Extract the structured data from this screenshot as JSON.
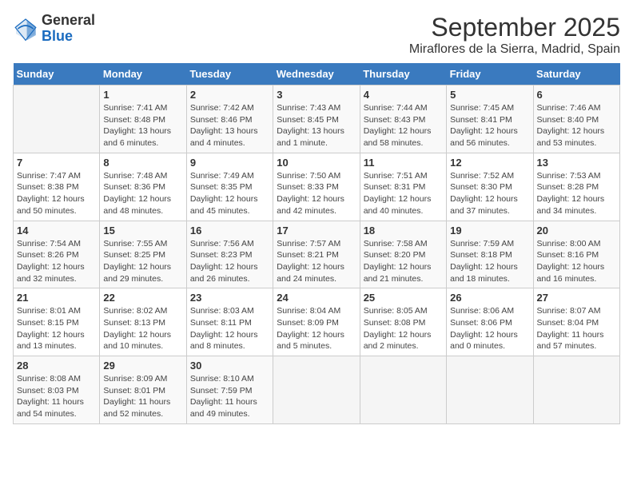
{
  "logo": {
    "general": "General",
    "blue": "Blue"
  },
  "title": "September 2025",
  "subtitle": "Miraflores de la Sierra, Madrid, Spain",
  "weekdays": [
    "Sunday",
    "Monday",
    "Tuesday",
    "Wednesday",
    "Thursday",
    "Friday",
    "Saturday"
  ],
  "weeks": [
    [
      null,
      {
        "day": 1,
        "sunrise": "7:41 AM",
        "sunset": "8:48 PM",
        "daylight": "13 hours and 6 minutes."
      },
      {
        "day": 2,
        "sunrise": "7:42 AM",
        "sunset": "8:46 PM",
        "daylight": "13 hours and 4 minutes."
      },
      {
        "day": 3,
        "sunrise": "7:43 AM",
        "sunset": "8:45 PM",
        "daylight": "13 hours and 1 minute."
      },
      {
        "day": 4,
        "sunrise": "7:44 AM",
        "sunset": "8:43 PM",
        "daylight": "12 hours and 58 minutes."
      },
      {
        "day": 5,
        "sunrise": "7:45 AM",
        "sunset": "8:41 PM",
        "daylight": "12 hours and 56 minutes."
      },
      {
        "day": 6,
        "sunrise": "7:46 AM",
        "sunset": "8:40 PM",
        "daylight": "12 hours and 53 minutes."
      }
    ],
    [
      {
        "day": 7,
        "sunrise": "7:47 AM",
        "sunset": "8:38 PM",
        "daylight": "12 hours and 50 minutes."
      },
      {
        "day": 8,
        "sunrise": "7:48 AM",
        "sunset": "8:36 PM",
        "daylight": "12 hours and 48 minutes."
      },
      {
        "day": 9,
        "sunrise": "7:49 AM",
        "sunset": "8:35 PM",
        "daylight": "12 hours and 45 minutes."
      },
      {
        "day": 10,
        "sunrise": "7:50 AM",
        "sunset": "8:33 PM",
        "daylight": "12 hours and 42 minutes."
      },
      {
        "day": 11,
        "sunrise": "7:51 AM",
        "sunset": "8:31 PM",
        "daylight": "12 hours and 40 minutes."
      },
      {
        "day": 12,
        "sunrise": "7:52 AM",
        "sunset": "8:30 PM",
        "daylight": "12 hours and 37 minutes."
      },
      {
        "day": 13,
        "sunrise": "7:53 AM",
        "sunset": "8:28 PM",
        "daylight": "12 hours and 34 minutes."
      }
    ],
    [
      {
        "day": 14,
        "sunrise": "7:54 AM",
        "sunset": "8:26 PM",
        "daylight": "12 hours and 32 minutes."
      },
      {
        "day": 15,
        "sunrise": "7:55 AM",
        "sunset": "8:25 PM",
        "daylight": "12 hours and 29 minutes."
      },
      {
        "day": 16,
        "sunrise": "7:56 AM",
        "sunset": "8:23 PM",
        "daylight": "12 hours and 26 minutes."
      },
      {
        "day": 17,
        "sunrise": "7:57 AM",
        "sunset": "8:21 PM",
        "daylight": "12 hours and 24 minutes."
      },
      {
        "day": 18,
        "sunrise": "7:58 AM",
        "sunset": "8:20 PM",
        "daylight": "12 hours and 21 minutes."
      },
      {
        "day": 19,
        "sunrise": "7:59 AM",
        "sunset": "8:18 PM",
        "daylight": "12 hours and 18 minutes."
      },
      {
        "day": 20,
        "sunrise": "8:00 AM",
        "sunset": "8:16 PM",
        "daylight": "12 hours and 16 minutes."
      }
    ],
    [
      {
        "day": 21,
        "sunrise": "8:01 AM",
        "sunset": "8:15 PM",
        "daylight": "12 hours and 13 minutes."
      },
      {
        "day": 22,
        "sunrise": "8:02 AM",
        "sunset": "8:13 PM",
        "daylight": "12 hours and 10 minutes."
      },
      {
        "day": 23,
        "sunrise": "8:03 AM",
        "sunset": "8:11 PM",
        "daylight": "12 hours and 8 minutes."
      },
      {
        "day": 24,
        "sunrise": "8:04 AM",
        "sunset": "8:09 PM",
        "daylight": "12 hours and 5 minutes."
      },
      {
        "day": 25,
        "sunrise": "8:05 AM",
        "sunset": "8:08 PM",
        "daylight": "12 hours and 2 minutes."
      },
      {
        "day": 26,
        "sunrise": "8:06 AM",
        "sunset": "8:06 PM",
        "daylight": "12 hours and 0 minutes."
      },
      {
        "day": 27,
        "sunrise": "8:07 AM",
        "sunset": "8:04 PM",
        "daylight": "11 hours and 57 minutes."
      }
    ],
    [
      {
        "day": 28,
        "sunrise": "8:08 AM",
        "sunset": "8:03 PM",
        "daylight": "11 hours and 54 minutes."
      },
      {
        "day": 29,
        "sunrise": "8:09 AM",
        "sunset": "8:01 PM",
        "daylight": "11 hours and 52 minutes."
      },
      {
        "day": 30,
        "sunrise": "8:10 AM",
        "sunset": "7:59 PM",
        "daylight": "11 hours and 49 minutes."
      },
      null,
      null,
      null,
      null
    ]
  ]
}
